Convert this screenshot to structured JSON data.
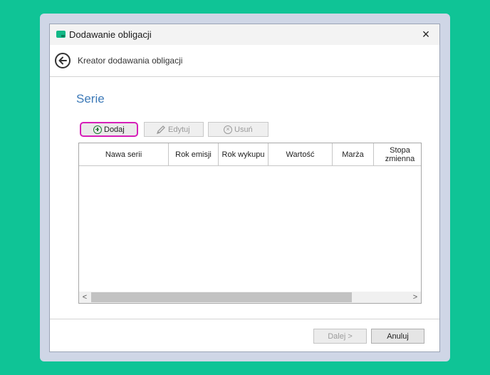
{
  "window": {
    "title": "Dodawanie obligacji",
    "close_symbol": "×"
  },
  "wizard": {
    "title": "Kreator dodawania obligacji",
    "back_icon": "arrow-left-circle-icon"
  },
  "section": {
    "title": "Serie"
  },
  "toolbar": {
    "add_label": "Dodaj",
    "edit_label": "Edytuj",
    "delete_label": "Usuń",
    "delete_symbol": "×"
  },
  "grid": {
    "columns": [
      {
        "label": "Nawa serii"
      },
      {
        "label": "Rok emisji"
      },
      {
        "label": "Rok wykupu"
      },
      {
        "label": "Wartość"
      },
      {
        "label": "Marża"
      },
      {
        "label": "Stopa zmienna"
      }
    ],
    "rows": [],
    "scroll_left_symbol": "<",
    "scroll_right_symbol": ">"
  },
  "footer": {
    "next_label": "Dalej >",
    "cancel_label": "Anuluj"
  },
  "colors": {
    "background": "#0fc496",
    "accent": "#3d7ab8",
    "highlight": "#d61fb8",
    "add_icon": "#1e7a33"
  }
}
